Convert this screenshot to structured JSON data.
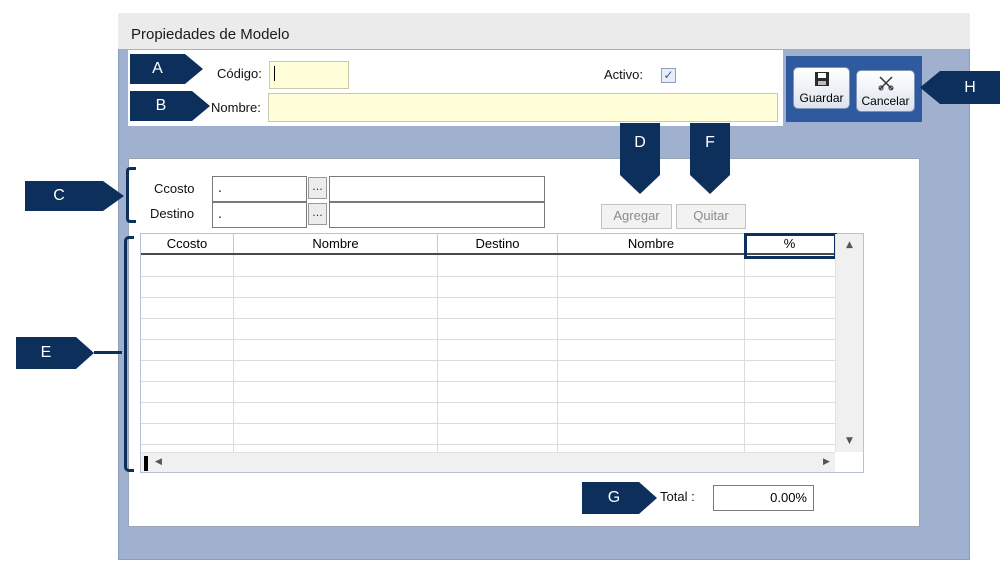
{
  "window": {
    "title": "Propiedades de Modelo"
  },
  "header": {
    "codigo_label": "Código:",
    "codigo_value": "",
    "nombre_label": "Nombre:",
    "nombre_value": "",
    "activo_label": "Activo:",
    "activo_checked": true,
    "check_glyph": "✓"
  },
  "toolbar": {
    "save_label": "Guardar",
    "cancel_label": "Cancelar",
    "save_icon": "floppy-disk-icon",
    "cancel_icon": "scissors-x-icon"
  },
  "filters": {
    "ccosto_label": "Ccosto",
    "ccosto_code": ".",
    "ccosto_name": "",
    "destino_label": "Destino",
    "destino_code": ".",
    "destino_name": "",
    "browse_label": "...",
    "add_label": "Agregar",
    "remove_label": "Quitar"
  },
  "grid": {
    "columns": [
      "Ccosto",
      "Nombre",
      "Destino",
      "Nombre",
      "%"
    ],
    "rows": []
  },
  "footer": {
    "total_label": "Total :",
    "total_value": "0.00%"
  },
  "annotations": {
    "a": "A",
    "b": "B",
    "c": "C",
    "d": "D",
    "e": "E",
    "f": "F",
    "g": "G",
    "h": "H"
  },
  "colors": {
    "accent": "#0d2f5c",
    "window_bg": "#9fb1cf",
    "toolbar_bg": "#2f5a9f",
    "input_yellow": "#fffed8"
  }
}
